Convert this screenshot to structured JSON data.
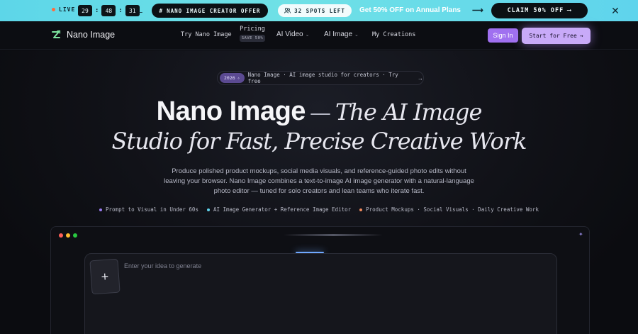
{
  "promo": {
    "live_label": "LIVE",
    "timer": [
      "29",
      "48",
      "31"
    ],
    "timer_sep": ":",
    "prompt_glyph": "›_",
    "offer_icon": "#",
    "offer_label": "NANO IMAGE CREATOR OFFER",
    "spots_label": "32 SPOTS LEFT",
    "headline": "Get 50% OFF on Annual Plans",
    "arrow": "⟶",
    "claim_label": "CLAIM 50% OFF",
    "claim_arrow": "⟶",
    "close_glyph": "✕",
    "colors": {
      "bar": "#5dd6e8",
      "live_dot": "#ff6a3d",
      "dark_pill": "#0b1014"
    }
  },
  "nav": {
    "brand": "Nano Image",
    "try_label": "Try Nano Image",
    "pricing_label": "Pricing",
    "pricing_badge": "SAVE 50%",
    "ai_video_label": "AI Video",
    "ai_image_label": "AI Image",
    "caret": "⌄",
    "my_creations_label": "My Creations",
    "sign_in_label": "Sign In",
    "start_free_label": "Start for Free",
    "start_free_arrow": "→",
    "colors": {
      "sign_in": "#a070f0",
      "start_free": "#c8aaf8",
      "logo": "#7ee6a0"
    }
  },
  "hero": {
    "tag_badge": "2026",
    "tag_badge_icon": "✧",
    "tag_text": "Nano Image · AI image studio for creators · Try free",
    "tag_arrow": "→",
    "title_bold": "Nano Image",
    "title_dash": "—",
    "title_italic_1": "The AI Image",
    "title_italic_2": "Studio for Fast, Precise Creative Work",
    "subtext": "Produce polished product mockups, social media visuals, and reference-guided photo edits without leaving your browser. Nano Image combines a text-to-image AI image generator with a natural-language photo editor — tuned for solo creators and lean teams who iterate fast.",
    "features": [
      {
        "label": "Prompt to Visual in Under 60s",
        "color": "#9a7cf0"
      },
      {
        "label": "AI Image Generator + Reference Image Editor",
        "color": "#5fd4ec"
      },
      {
        "label": "Product Mockups · Social Visuals · Daily Creative Work",
        "color": "#f08a5d"
      }
    ]
  },
  "editor": {
    "window_dots": [
      "#ff5f57",
      "#febc2e",
      "#28c840"
    ],
    "sparkle": "✦",
    "add_glyph": "+",
    "input_placeholder": "Enter your idea to generate"
  }
}
